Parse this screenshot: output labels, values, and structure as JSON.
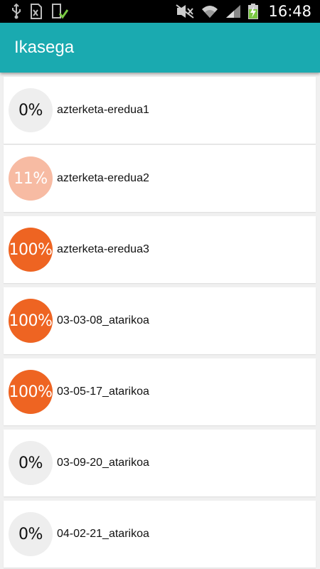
{
  "status_bar": {
    "time": "16:48",
    "icons": [
      "usb-icon",
      "sim-warning-icon",
      "download-done-icon",
      "mute-icon",
      "wifi-icon",
      "signal-icon",
      "battery-charging-icon"
    ]
  },
  "app_bar": {
    "title": "Ikasega"
  },
  "items": [
    {
      "progress": "0%",
      "label": "azterketa-eredua1"
    },
    {
      "progress": "11%",
      "label": "azterketa-eredua2"
    },
    {
      "progress": "100%",
      "label": "azterketa-eredua3"
    },
    {
      "progress": "100%",
      "label": "03-03-08_atarikoa"
    },
    {
      "progress": "100%",
      "label": "03-05-17_atarikoa"
    },
    {
      "progress": "0%",
      "label": "03-09-20_atarikoa"
    },
    {
      "progress": "0%",
      "label": "04-02-21_atarikoa"
    }
  ],
  "colors": {
    "app_bar": "#1aaab0",
    "complete": "#ee6422",
    "partial": "#f7bba3",
    "empty": "#eeeeee"
  }
}
